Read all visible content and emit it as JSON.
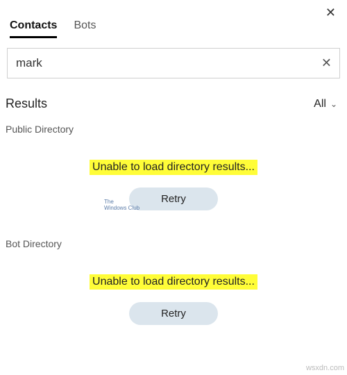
{
  "close_icon_glyph": "✕",
  "tabs": {
    "contacts": "Contacts",
    "bots": "Bots"
  },
  "search": {
    "value": "mark ",
    "clear_glyph": "✕"
  },
  "results": {
    "title": "Results",
    "filter_label": "All",
    "chevron_glyph": "⌄"
  },
  "sections": {
    "public": {
      "label": "Public Directory",
      "error": "Unable to load directory results...",
      "retry": "Retry"
    },
    "bot": {
      "label": "Bot Directory",
      "error": "Unable to load directory results...",
      "retry": "Retry"
    }
  },
  "watermark": {
    "line1": "The",
    "line2": "Windows Club"
  },
  "site_mark": "wsxdn.com"
}
